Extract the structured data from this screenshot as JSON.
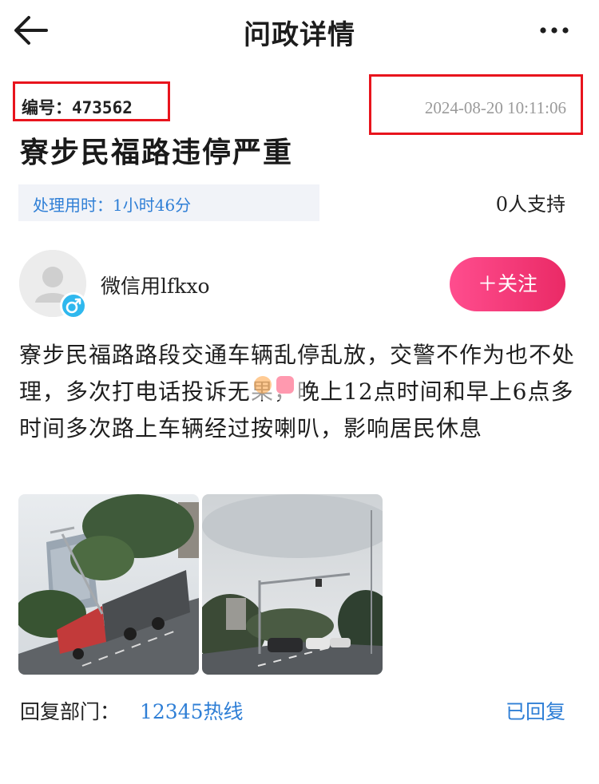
{
  "header": {
    "title": "问政详情",
    "back_icon": "arrow-left-icon",
    "more_icon": "more-dots-icon"
  },
  "meta": {
    "id_text": "编号：473562",
    "time": "2024-08-20 10:11:06",
    "highlight_color": "#e8141d"
  },
  "post": {
    "title": "寮步民福路违停严重",
    "duration": "处理用时：1小时46分",
    "support": "0人支持",
    "body": "寮步民福路路段交通车辆乱停乱放，交警不作为也不处理，多次打电话投诉无果，晚上12点时间和早上6点多时间多次路上车辆经过按喇叭，影响居民休息"
  },
  "user": {
    "name": "微信用lfkxo",
    "avatar_icon": "default-avatar-icon",
    "gender_icon": "male-icon",
    "follow_label": "＋关注"
  },
  "images": [
    {
      "name": "street-photo-trucks"
    },
    {
      "name": "street-photo-road"
    }
  ],
  "reply": {
    "label": "回复部门：",
    "department": "12345热线",
    "status": "已回复"
  },
  "colors": {
    "accent_blue": "#2f7fd6",
    "follow_pink": "#ea2a66",
    "gender_badge": "#2fb8ee"
  }
}
